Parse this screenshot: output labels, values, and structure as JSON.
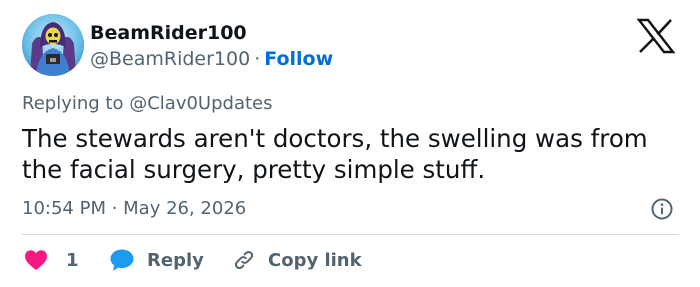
{
  "author": {
    "display_name": "BeamRider100",
    "handle": "@BeamRider100",
    "separator": "·",
    "follow_label": "Follow"
  },
  "tweet": {
    "reply_prefix": "Replying to",
    "reply_to": "@Clav0Updates",
    "text": "The stewards aren't doctors, the swelling was from the facial surgery, pretty simple stuff.",
    "timestamp": "10:54 PM · May 26, 2026"
  },
  "actions": {
    "like_count": "1",
    "reply_label": "Reply",
    "copy_link_label": "Copy link"
  },
  "icons": {
    "platform": "x-logo-icon",
    "info": "info-icon",
    "like": "heart-icon",
    "reply": "speech-bubble-icon",
    "copy": "link-icon"
  },
  "colors": {
    "link_blue": "#006fd6",
    "like_pink": "#f91880",
    "reply_blue": "#1d9bf0",
    "muted_gray": "#536471",
    "text": "#0f1419",
    "divider": "#cfd9de"
  }
}
